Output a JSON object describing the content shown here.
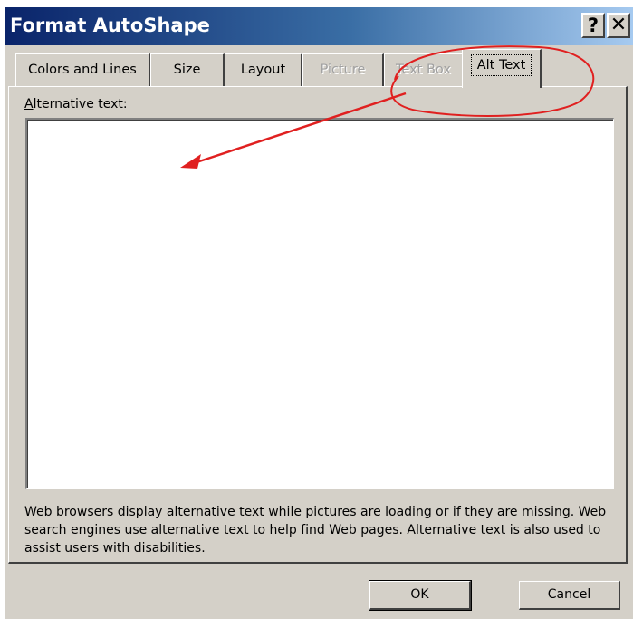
{
  "window": {
    "title": "Format AutoShape",
    "help_glyph": "?",
    "close_glyph": "✕"
  },
  "tabs": [
    {
      "label": "Colors and Lines",
      "state": "normal"
    },
    {
      "label": "Size",
      "state": "normal"
    },
    {
      "label": "Layout",
      "state": "normal"
    },
    {
      "label": "Picture",
      "state": "disabled"
    },
    {
      "label": "Text Box",
      "state": "disabled"
    },
    {
      "label": "Alt Text",
      "state": "active"
    }
  ],
  "alt_text": {
    "label_accel": "A",
    "label_rest": "lternative text:",
    "value": "",
    "help": "Web browsers display alternative text while pictures are loading or if they are missing.  Web search engines use alternative text to help find Web pages.  Alternative text is also used to assist users with disabilities."
  },
  "buttons": {
    "ok": "OK",
    "cancel": "Cancel"
  },
  "annotation": {
    "color": "#e02020"
  }
}
